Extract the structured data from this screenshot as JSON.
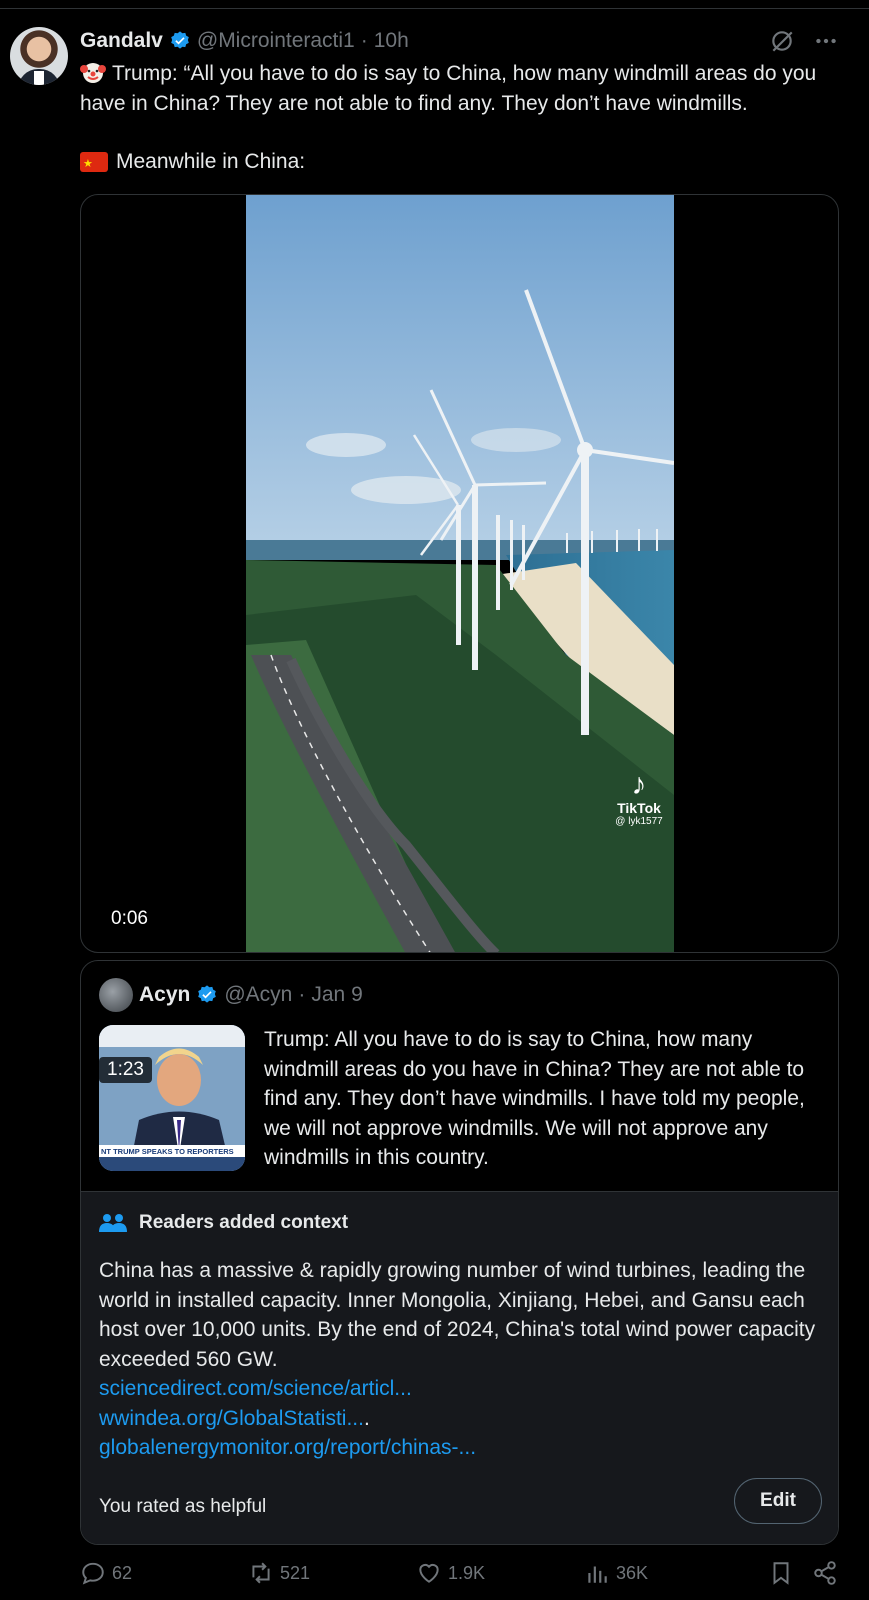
{
  "colors": {
    "background": "#000000",
    "text": "#e7e9ea",
    "muted": "#71767b",
    "link": "#1d9bf0",
    "verified": "#1d9bf0",
    "notes_bg": "#16181c"
  },
  "post": {
    "author_name": "Gandalv",
    "handle": "@Microinteracti1",
    "separator": "·",
    "time": "10h",
    "emoji_icon": "clown-face-icon",
    "text": "Trump: “All you have to do is say to China, how many windmill areas do you have in China? They are not able to find any. They don’t have windmills.",
    "second_line": "Meanwhile in China:",
    "flag_icon": "china-flag-icon"
  },
  "video": {
    "duration": "0:06",
    "watermark_brand": "TikTok",
    "watermark_user": "@ lyk1577"
  },
  "quote": {
    "author_name": "Acyn",
    "handle": "@Acyn",
    "separator": "·",
    "date": "Jan 9",
    "thumb_duration": "1:23",
    "thumb_banner": "NT TRUMP SPEAKS TO REPORTERS",
    "text": "Trump: All you have to do is say to China, how many windmill areas do you have in China? They are not able to find any. They don’t have windmills. I have told my people, we will not approve windmills. We will not approve any windmills in this country."
  },
  "community_note": {
    "heading": "Readers added context",
    "body": "China has a massive & rapidly growing number of wind turbines, leading the world in installed capacity. Inner Mongolia, Xinjiang, Hebei, and Gansu each host over 10,000 units. By the end of 2024, China's total wind power capacity exceeded 560 GW.",
    "links": [
      {
        "text": "sciencedirect.com/science/articl..."
      },
      {
        "text": "wwindea.org/GlobalStatisti...",
        "suffix": "."
      },
      {
        "text": "globalenergymonitor.org/report/chinas-..."
      }
    ],
    "rated_text": "You rated as helpful",
    "edit_label": "Edit"
  },
  "actions": {
    "replies": "62",
    "reposts": "521",
    "likes": "1.9K",
    "views": "36K"
  }
}
